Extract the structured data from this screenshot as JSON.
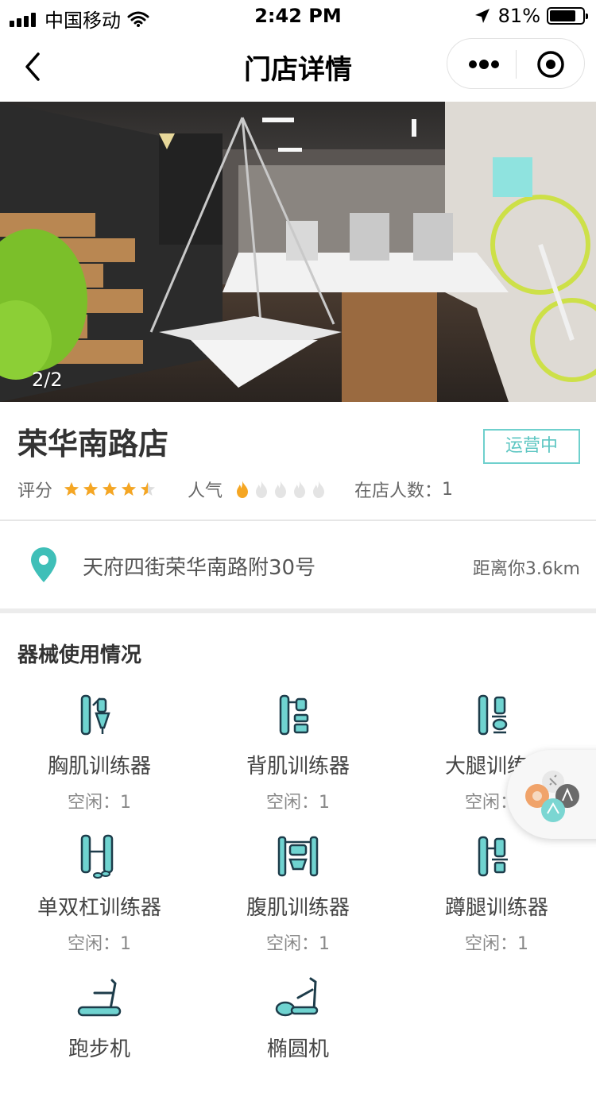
{
  "status_bar": {
    "carrier": "中国移动",
    "time": "2:42 PM",
    "battery": "81%"
  },
  "nav": {
    "title": "门店详情"
  },
  "hero": {
    "indicator": "2/2"
  },
  "store": {
    "name": "荣华南路店",
    "status": "运营中",
    "rating_label": "评分",
    "rating": 4.5,
    "popularity_label": "人气",
    "popularity": 1,
    "in_store_label": "在店人数：",
    "in_store_count": "1"
  },
  "address": {
    "text": "天府四街荣华南路附30号",
    "distance": "距离你3.6km"
  },
  "equipment": {
    "title": "器械使用情况",
    "items": [
      {
        "name": "胸肌训练器",
        "free": "空闲：1",
        "icon": "chest-trainer-icon"
      },
      {
        "name": "背肌训练器",
        "free": "空闲：1",
        "icon": "back-trainer-icon"
      },
      {
        "name": "大腿训练器",
        "free": "空闲：1",
        "icon": "thigh-trainer-icon"
      },
      {
        "name": "单双杠训练器",
        "free": "空闲：1",
        "icon": "bars-trainer-icon"
      },
      {
        "name": "腹肌训练器",
        "free": "空闲：1",
        "icon": "abs-trainer-icon"
      },
      {
        "name": "蹲腿训练器",
        "free": "空闲：1",
        "icon": "squat-trainer-icon"
      },
      {
        "name": "跑步机",
        "free": "",
        "icon": "treadmill-icon"
      },
      {
        "name": "椭圆机",
        "free": "",
        "icon": "elliptical-icon"
      }
    ]
  },
  "colors": {
    "accent": "#5cc6c2",
    "teal_icon": "#6fd3d0",
    "star": "#f5a623",
    "flame": "#f5a623"
  }
}
